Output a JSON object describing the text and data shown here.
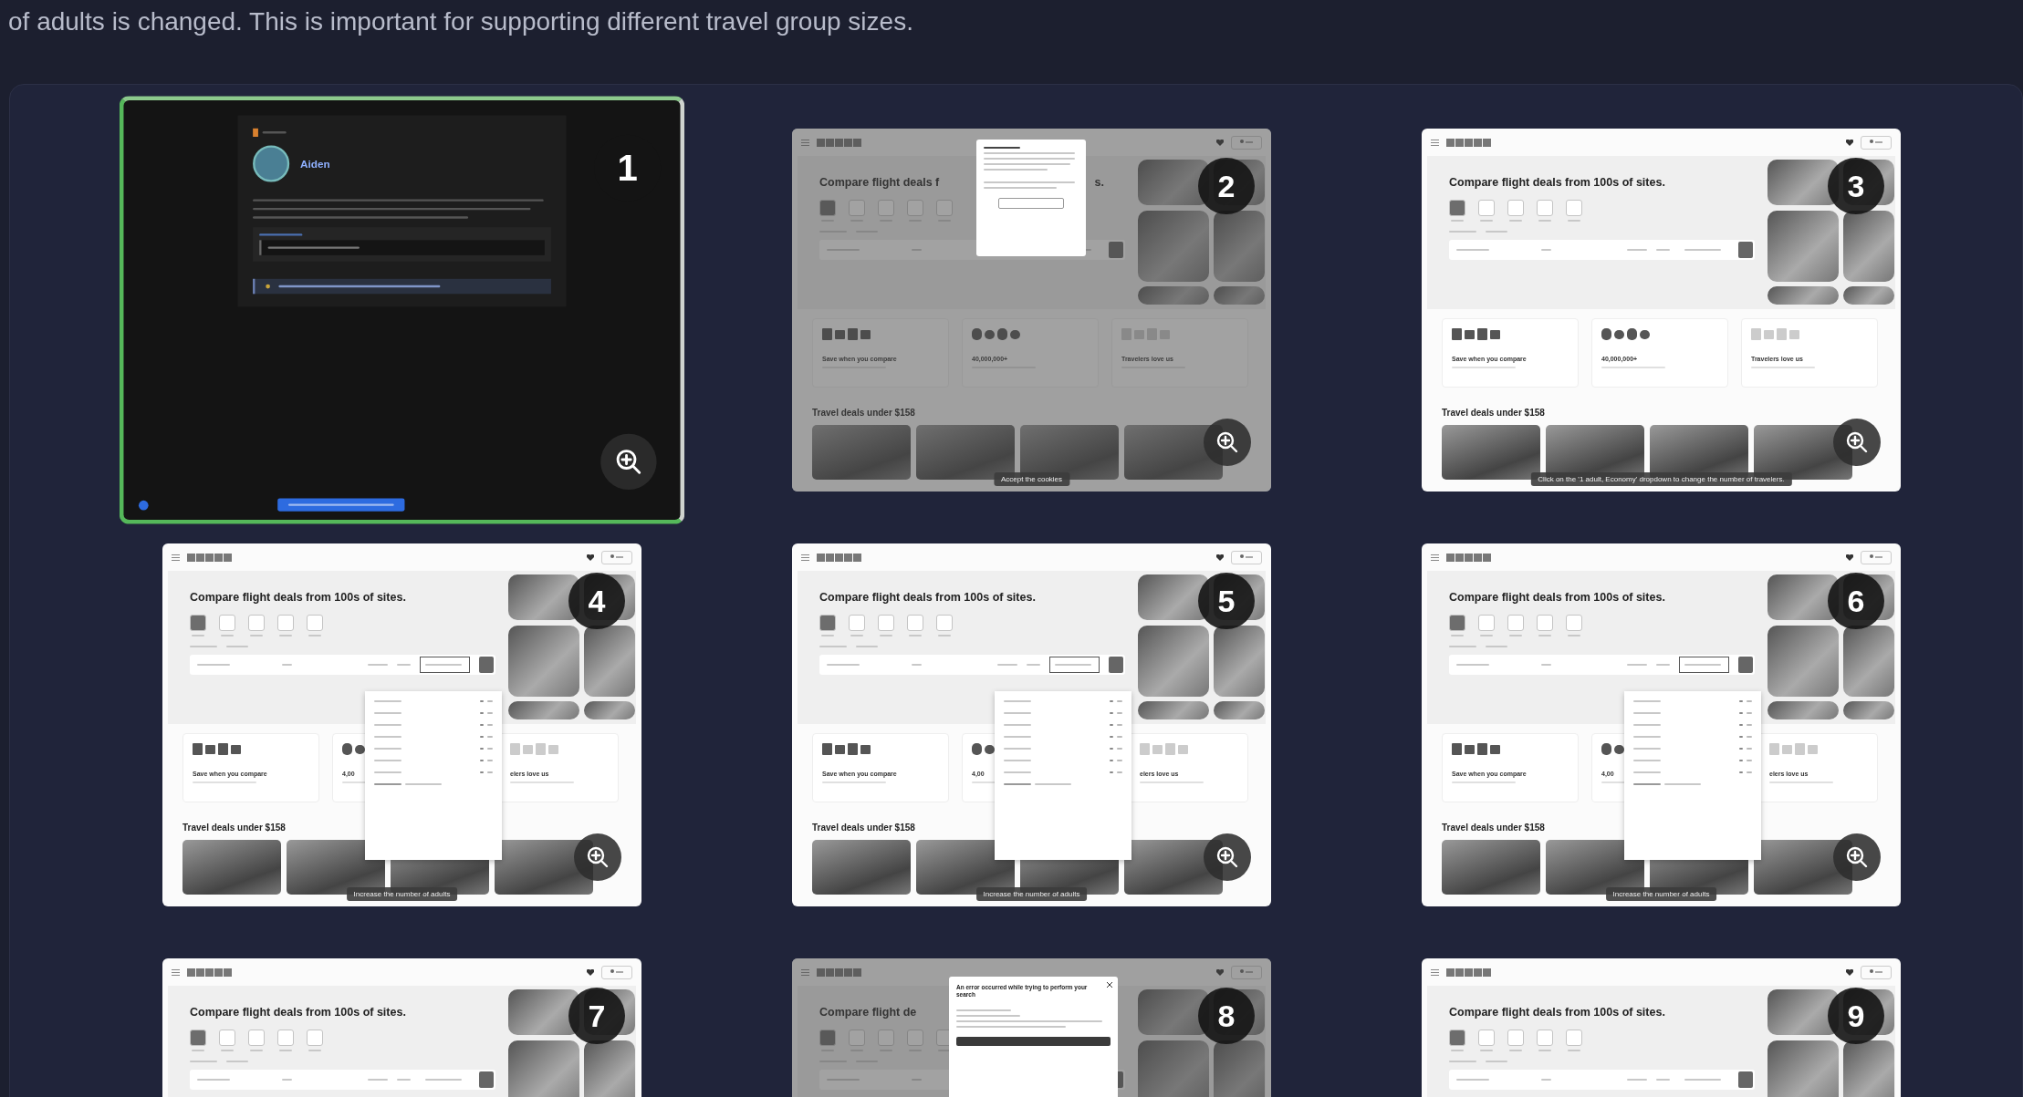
{
  "description_tail": "of adults is changed. This is important for supporting different travel group sizes.",
  "steps": [
    {
      "kind": "intro",
      "number": "1",
      "selected": true,
      "user_name": "Aiden"
    },
    {
      "kind": "site",
      "number": "2",
      "selected": false,
      "headline": "Compare flight deals f",
      "headline_tail": "s.",
      "categories": [
        {
          "selected": true
        },
        {
          "selected": false
        },
        {
          "selected": false
        },
        {
          "selected": false
        },
        {
          "selected": false
        }
      ],
      "modal": {
        "kind": "consent"
      },
      "features": [
        "Save when you compare",
        "40,000,000+",
        "Travelers love us"
      ],
      "deals_title": "Travel deals under $158",
      "tooltip": "Accept the cookies"
    },
    {
      "kind": "site",
      "number": "3",
      "selected": false,
      "headline": "Compare flight deals from 100s of sites.",
      "categories": [
        {
          "selected": true
        },
        {
          "selected": false
        },
        {
          "selected": false
        },
        {
          "selected": false
        },
        {
          "selected": false
        }
      ],
      "features": [
        "Save when you compare",
        "40,000,000+",
        "Travelers love us"
      ],
      "deals_title": "Travel deals under $158",
      "tooltip": "Click on the '1 adult, Economy' dropdown to change the number of travelers."
    },
    {
      "kind": "site",
      "number": "4",
      "selected": false,
      "headline": "Compare flight deals from 100s of sites.",
      "categories": [
        {
          "selected": true
        },
        {
          "selected": false
        },
        {
          "selected": false
        },
        {
          "selected": false
        },
        {
          "selected": false
        }
      ],
      "dropdown": true,
      "features": [
        "Save when you compare",
        "4,00",
        "elers love us"
      ],
      "deals_title": "Travel deals under $158",
      "tooltip": "Increase the number of adults"
    },
    {
      "kind": "site",
      "number": "5",
      "selected": false,
      "headline": "Compare flight deals from 100s of sites.",
      "categories": [
        {
          "selected": true
        },
        {
          "selected": false
        },
        {
          "selected": false
        },
        {
          "selected": false
        },
        {
          "selected": false
        }
      ],
      "dropdown": true,
      "features": [
        "Save when you compare",
        "4,00",
        "elers love us"
      ],
      "deals_title": "Travel deals under $158",
      "tooltip": "Increase the number of adults"
    },
    {
      "kind": "site",
      "number": "6",
      "selected": false,
      "headline": "Compare flight deals from 100s of sites.",
      "categories": [
        {
          "selected": true
        },
        {
          "selected": false
        },
        {
          "selected": false
        },
        {
          "selected": false
        },
        {
          "selected": false
        }
      ],
      "dropdown": true,
      "features": [
        "Save when you compare",
        "4,00",
        "elers love us"
      ],
      "deals_title": "Travel deals under $158",
      "tooltip": "Increase the number of adults"
    },
    {
      "kind": "site",
      "number": "7",
      "selected": false,
      "headline": "Compare flight deals from 100s of sites.",
      "categories": [
        {
          "selected": true
        },
        {
          "selected": false
        },
        {
          "selected": false
        },
        {
          "selected": false
        },
        {
          "selected": false
        }
      ]
    },
    {
      "kind": "site",
      "number": "8",
      "selected": false,
      "headline": "Compare flight de",
      "categories": [
        {
          "selected": true
        },
        {
          "selected": false
        },
        {
          "selected": false
        },
        {
          "selected": false
        },
        {
          "selected": false
        }
      ],
      "modal": {
        "kind": "error",
        "title": "An error occurred while trying to perform your search"
      }
    },
    {
      "kind": "site",
      "number": "9",
      "selected": false,
      "headline": "Compare flight deals from 100s of sites.",
      "categories": [
        {
          "selected": true
        },
        {
          "selected": false
        },
        {
          "selected": false
        },
        {
          "selected": false
        },
        {
          "selected": false
        }
      ]
    }
  ]
}
